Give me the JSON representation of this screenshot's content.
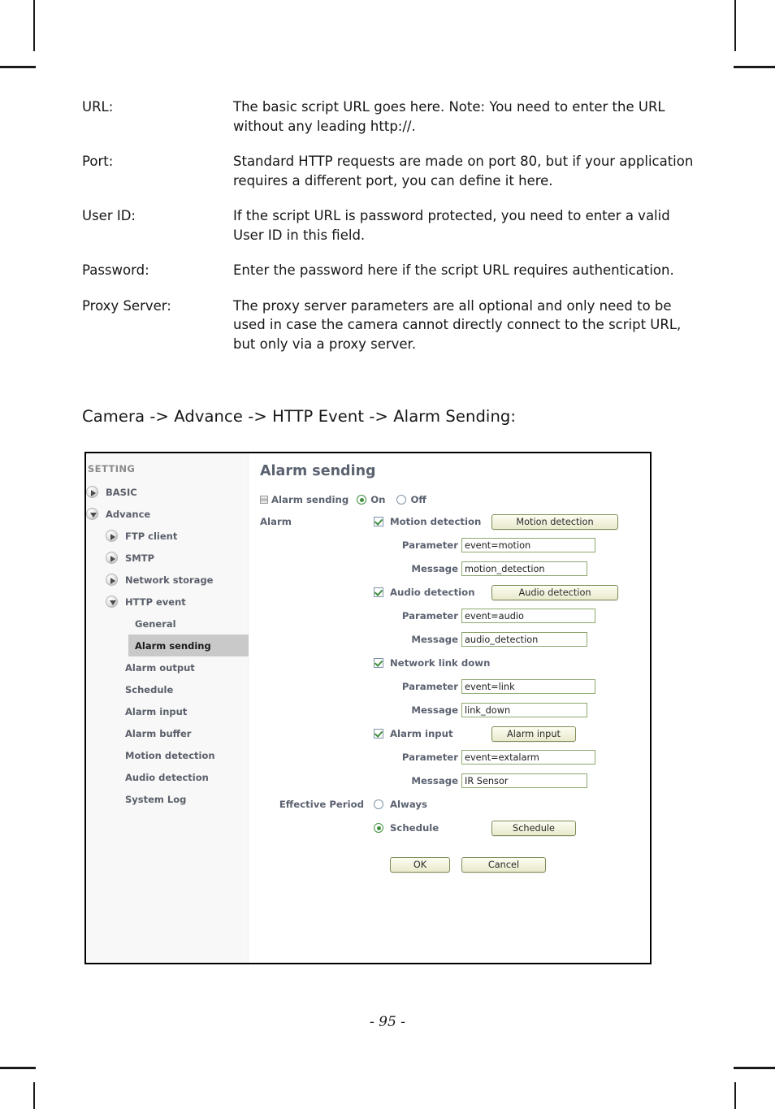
{
  "document": {
    "definitions": [
      {
        "term": "URL:",
        "description": "The basic script URL goes here. Note: You need to enter the URL without any leading http://."
      },
      {
        "term": "Port:",
        "description": "Standard HTTP requests are made on port 80, but if your application requires a different port, you can define it here."
      },
      {
        "term": "User ID:",
        "description": "If the script URL is password protected, you need to enter a valid User ID in this field."
      },
      {
        "term": "Password:",
        "description": "Enter the password here if the script URL requires authentication."
      },
      {
        "term": "Proxy Server:",
        "description": "The proxy server parameters are all optional and only need to be used in case the camera cannot directly connect to the script URL, but only via a proxy server."
      }
    ],
    "section_heading": "Camera -> Advance -> HTTP Event -> Alarm Sending:",
    "page_number": "- 95 -"
  },
  "screenshot": {
    "sidebar": {
      "title": "SETTING",
      "items": [
        {
          "label": "BASIC",
          "level": 0,
          "icon": "triangle-right-icon",
          "selected": false
        },
        {
          "label": "Advance",
          "level": 0,
          "icon": "triangle-down-icon",
          "selected": false
        },
        {
          "label": "FTP client",
          "level": 1,
          "icon": "triangle-right-icon",
          "selected": false
        },
        {
          "label": "SMTP",
          "level": 1,
          "icon": "triangle-right-icon",
          "selected": false
        },
        {
          "label": "Network storage",
          "level": 1,
          "icon": "triangle-right-icon",
          "selected": false
        },
        {
          "label": "HTTP event",
          "level": 1,
          "icon": "triangle-down-icon",
          "selected": false
        },
        {
          "label": "General",
          "level": 2,
          "icon": "none",
          "selected": false
        },
        {
          "label": "Alarm sending",
          "level": 2,
          "icon": "none",
          "selected": true
        },
        {
          "label": "Alarm output",
          "level": 3,
          "icon": "none",
          "selected": false
        },
        {
          "label": "Schedule",
          "level": 3,
          "icon": "none",
          "selected": false
        },
        {
          "label": "Alarm input",
          "level": 3,
          "icon": "none",
          "selected": false
        },
        {
          "label": "Alarm buffer",
          "level": 3,
          "icon": "none",
          "selected": false
        },
        {
          "label": "Motion detection",
          "level": 3,
          "icon": "none",
          "selected": false
        },
        {
          "label": "Audio detection",
          "level": 3,
          "icon": "none",
          "selected": false
        },
        {
          "label": "System Log",
          "level": 3,
          "icon": "none",
          "selected": false
        }
      ]
    },
    "main": {
      "title": "Alarm sending",
      "toggle": {
        "label": "Alarm sending",
        "on_label": "On",
        "off_label": "Off",
        "selected": "On"
      },
      "alarm_label": "Alarm",
      "param_label": "Parameter",
      "message_label": "Message",
      "alarms": [
        {
          "name": "Motion detection",
          "checked": true,
          "button": "Motion detection",
          "has_button": true,
          "parameter": "event=motion",
          "message": "motion_detection"
        },
        {
          "name": "Audio detection",
          "checked": true,
          "button": "Audio detection",
          "has_button": true,
          "parameter": "event=audio",
          "message": "audio_detection"
        },
        {
          "name": "Network link down",
          "checked": true,
          "button": "",
          "has_button": false,
          "parameter": "event=link",
          "message": "link_down"
        },
        {
          "name": "Alarm input",
          "checked": true,
          "button": "Alarm input",
          "has_button": true,
          "parameter": "event=extalarm",
          "message": "IR Sensor"
        }
      ],
      "effective_period": {
        "label": "Effective Period",
        "always_label": "Always",
        "schedule_label": "Schedule",
        "schedule_button": "Schedule",
        "selected": "Schedule"
      },
      "ok_label": "OK",
      "cancel_label": "Cancel"
    }
  },
  "colors": {
    "accent_green": "#3f8f3f",
    "button_border": "#7d8c55",
    "input_border": "#8ca96e",
    "label_text": "#5b6270",
    "sidebar_bg": "#f7f8f7",
    "selected_bg": "#c9c9c9"
  }
}
